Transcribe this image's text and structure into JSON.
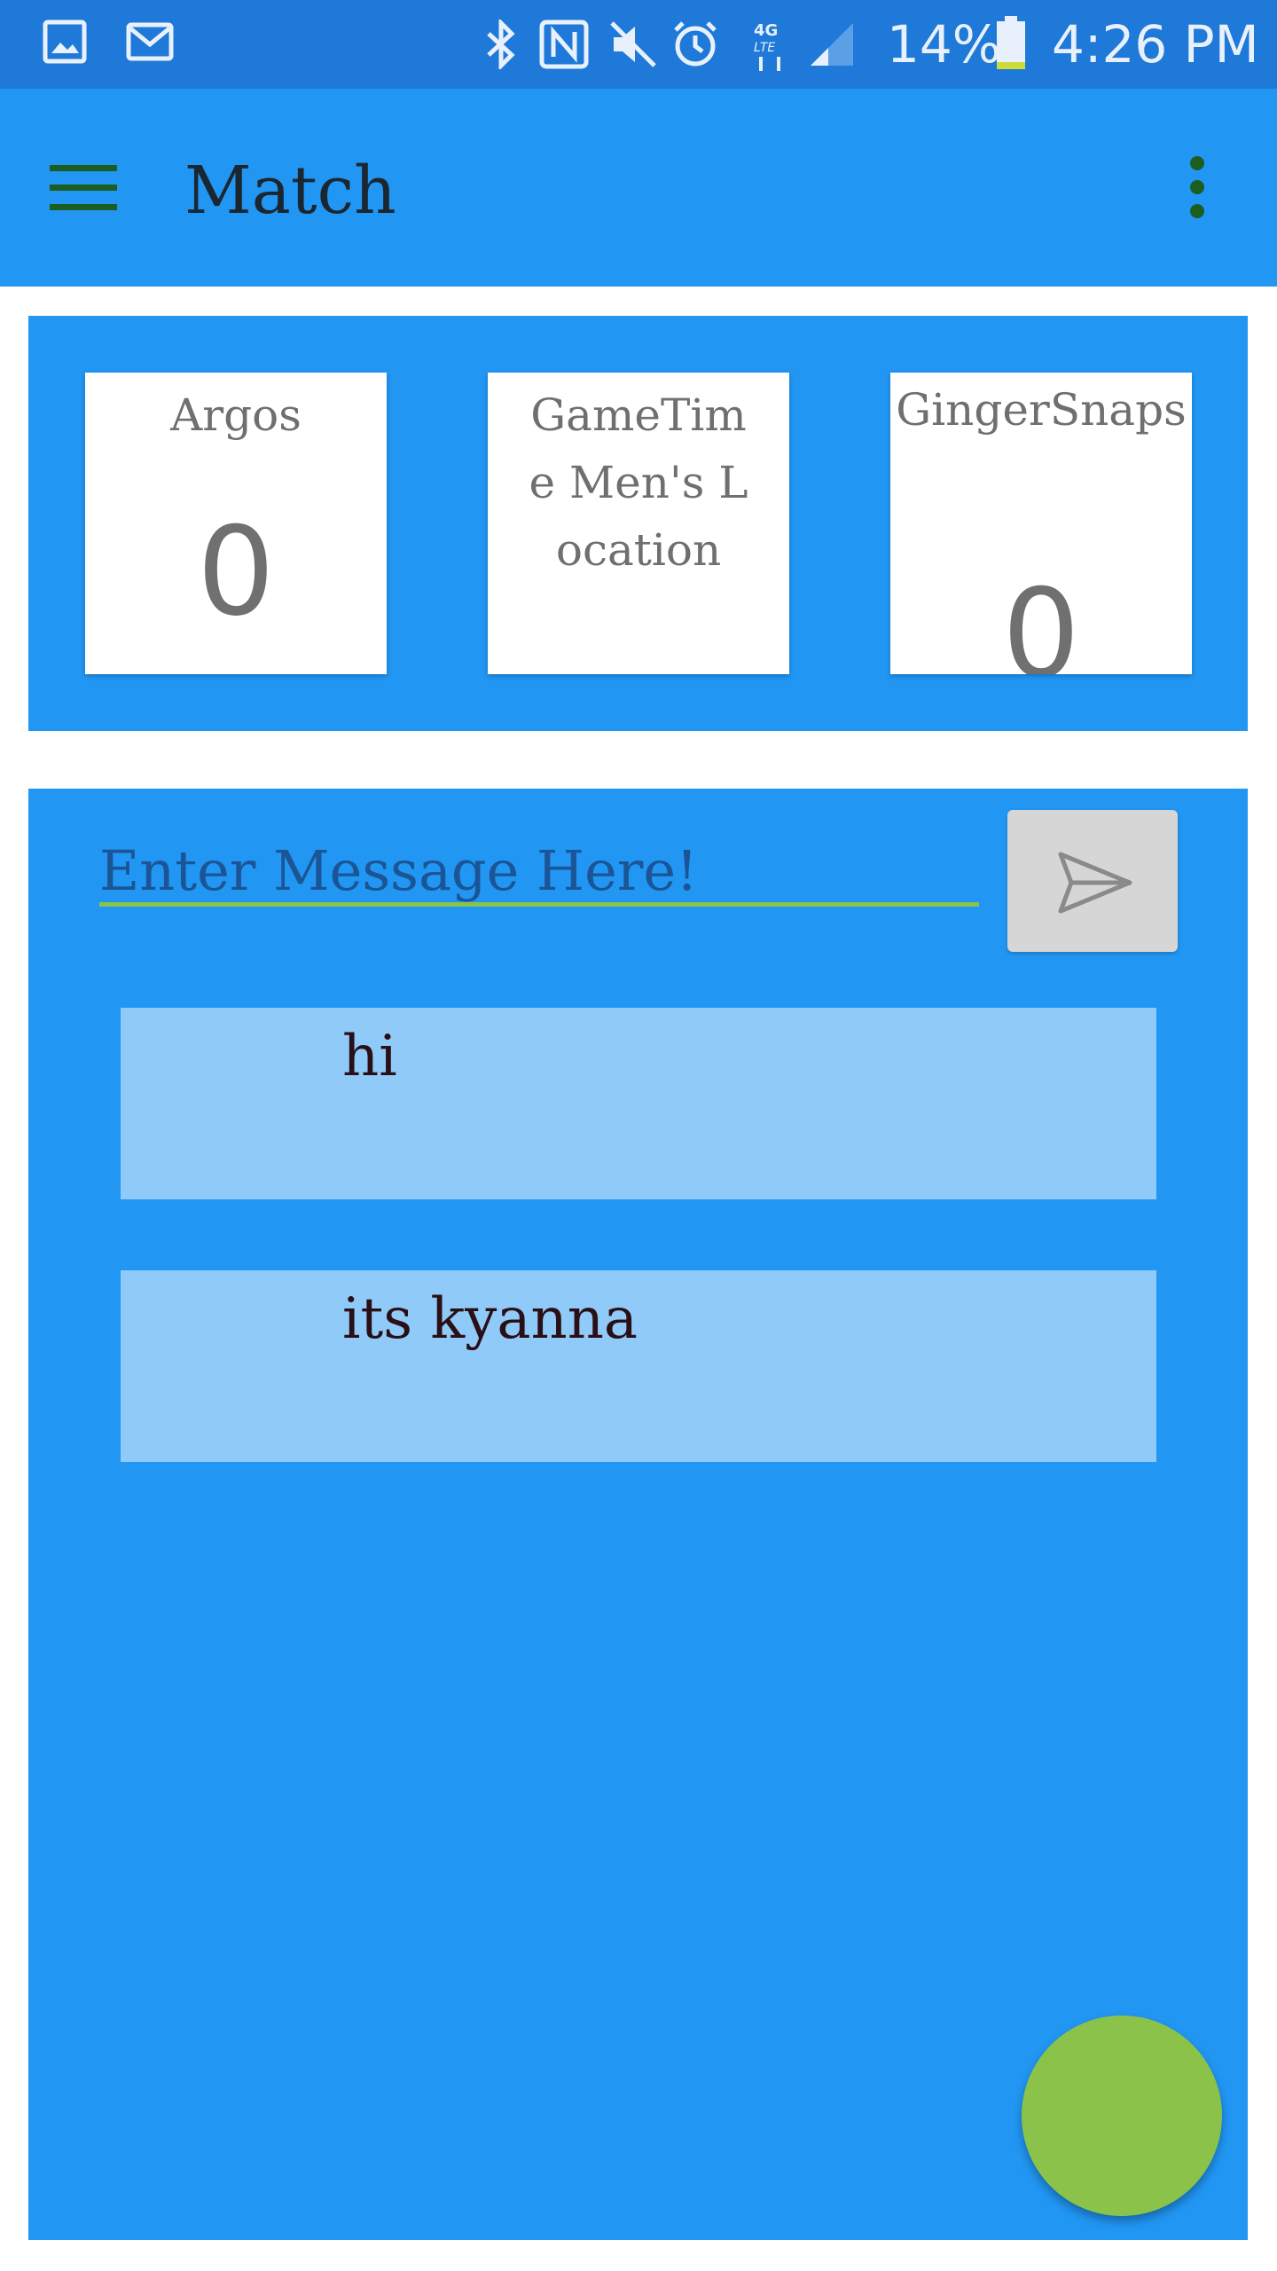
{
  "status_bar": {
    "battery": "14%",
    "time": "4:26 PM",
    "icons": [
      "gallery-icon",
      "gmail-icon",
      "bluetooth-icon",
      "nfc-icon",
      "mute-icon",
      "alarm-icon",
      "4g-lte-icon",
      "signal-icon",
      "battery-icon"
    ]
  },
  "app_bar": {
    "title": "Match",
    "icons": [
      "hamburger-menu-icon",
      "overflow-menu-icon"
    ]
  },
  "teams": [
    {
      "name": "Argos",
      "score": "0"
    },
    {
      "name": "GameTime Men's Location",
      "score": ""
    },
    {
      "name": "GingerSnaps",
      "score": "0"
    }
  ],
  "chat": {
    "input_placeholder": "Enter Message Here!",
    "send_icon": "send-icon",
    "messages": [
      {
        "text": "hi"
      },
      {
        "text": "its kyanna"
      }
    ]
  },
  "colors": {
    "primary": "#2196f3",
    "status_bar": "#1e79d8",
    "accent": "#8bc34a",
    "bubble": "#90caf9"
  }
}
